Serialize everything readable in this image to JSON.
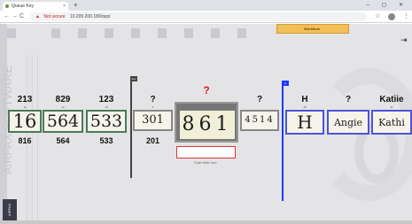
{
  "browser": {
    "tab_title": "Queue Key",
    "tab_close": "×",
    "new_tab": "+",
    "window_controls": "–  ▢  ✕",
    "not_secure": "Not secure",
    "url": "10.209.200.180/qvp/",
    "back": "←",
    "forward": "→",
    "reload": "C",
    "star": "☆",
    "menu": "⋮"
  },
  "app": {
    "workflow_label": "Workflow",
    "watermark": "AIRFAX SOFTWARE",
    "corner_logo": "AIRFAX",
    "current_answer": "?",
    "answer_hint": "Enter letter here",
    "left_divider_tag": "key",
    "right_divider_tag": "A"
  },
  "fields": [
    {
      "top": "213",
      "idx": "11",
      "image_text": "16",
      "bottom": "816"
    },
    {
      "top": "829",
      "idx": "12",
      "image_text": "564",
      "bottom": "564"
    },
    {
      "top": "123",
      "idx": "13",
      "image_text": "533",
      "bottom": "533"
    },
    {
      "top": "?",
      "idx": "5",
      "image_text": "301",
      "bottom": "201"
    },
    {
      "top": "?",
      "idx": "",
      "image_text": "861",
      "bottom": ""
    },
    {
      "top": "?",
      "idx": "",
      "image_text": "4514",
      "bottom": ""
    },
    {
      "top": "H",
      "idx": "48",
      "image_text": "H",
      "bottom": ""
    },
    {
      "top": "?",
      "idx": "",
      "image_text": "Angie",
      "bottom": ""
    },
    {
      "top": "Katiie",
      "idx": "41",
      "image_text": "Kathi",
      "bottom": ""
    }
  ],
  "colors": {
    "workflow_tab": "#f2be58",
    "current_answer": "#e02020",
    "right_divider": "#1a3cff",
    "input_border": "#d33333"
  }
}
